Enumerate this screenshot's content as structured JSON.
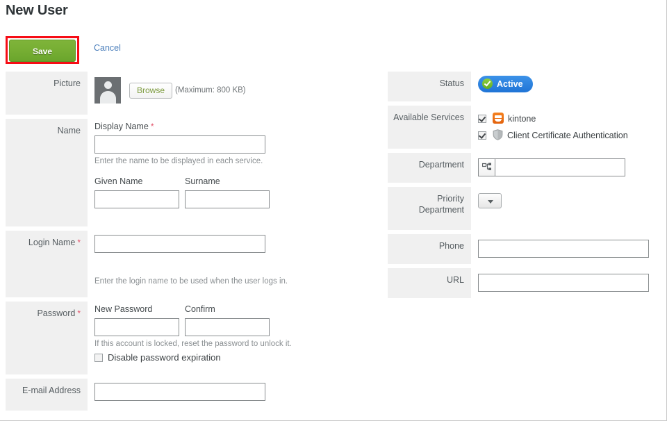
{
  "page": {
    "title": "New User"
  },
  "actions": {
    "save_label": "Save",
    "cancel_label": "Cancel",
    "highlight_color": "#f60d16",
    "save_color": "#76ae33",
    "cancel_color": "#4a7ebb"
  },
  "left_fields": {
    "picture": {
      "label": "Picture",
      "browse_label": "Browse",
      "max_note": "(Maximum: 800 KB)",
      "avatar_icon": "user-avatar-icon"
    },
    "name": {
      "label": "Name",
      "display_name_label": "Display Name",
      "display_name_required": "*",
      "display_name_value": "",
      "display_name_hint": "Enter the name to be displayed in each service.",
      "given_name_label": "Given Name",
      "given_name_value": "",
      "surname_label": "Surname",
      "surname_value": ""
    },
    "login_name": {
      "label": "Login Name",
      "required": "*",
      "value": "",
      "hint": "Enter the login name to be used when the user logs in."
    },
    "password": {
      "label": "Password",
      "required": "*",
      "new_password_label": "New Password",
      "new_password_value": "",
      "confirm_label": "Confirm",
      "confirm_value": "",
      "hint": "If this account is locked, reset the password to unlock it.",
      "disable_expiration_label": "Disable password expiration",
      "disable_expiration_checked": false
    },
    "email": {
      "label": "E-mail Address",
      "value": ""
    }
  },
  "right_fields": {
    "status": {
      "label": "Status",
      "value": "Active",
      "badge_color": "#1f74d6",
      "check_icon": "check-circle-icon"
    },
    "available_services": {
      "label": "Available Services",
      "items": [
        {
          "name": "kintone",
          "checked": true,
          "icon": "kintone-icon",
          "icon_color": "#e2620d"
        },
        {
          "name": "Client Certificate Authentication",
          "checked": true,
          "icon": "shield-icon",
          "icon_color": "#b0b4b6"
        }
      ]
    },
    "department": {
      "label": "Department",
      "value": "",
      "picker_icon": "org-tree-icon"
    },
    "priority_department": {
      "label": "Priority Department",
      "selected": "",
      "dropdown_icon": "chevron-down-icon"
    },
    "phone": {
      "label": "Phone",
      "value": ""
    },
    "url": {
      "label": "URL",
      "value": ""
    }
  }
}
